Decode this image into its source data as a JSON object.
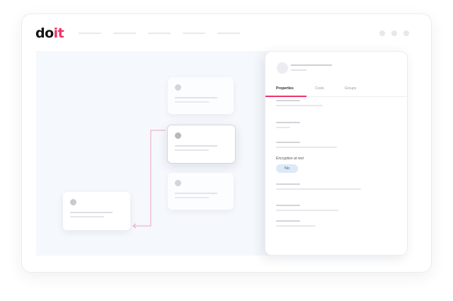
{
  "header": {
    "logo": {
      "part1": "do",
      "part2": "it"
    },
    "nav_count": 5,
    "window_controls": 3
  },
  "panel": {
    "tabs": [
      {
        "label": "Properties",
        "active": true
      },
      {
        "label": "Costs",
        "active": false
      },
      {
        "label": "Groups",
        "active": false
      }
    ],
    "field": {
      "label": "Encryption at rest",
      "value": "No"
    }
  },
  "colors": {
    "brand_accent": "#ee3368",
    "canvas_bg": "#f5f8fc",
    "badge_bg": "#dce9f7"
  }
}
